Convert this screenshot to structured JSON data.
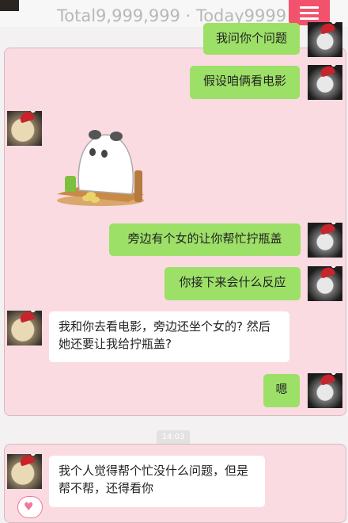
{
  "header": {
    "stats": "Total9,999,999 · Today9999"
  },
  "messages": [
    {
      "side": "right",
      "text": "我问你个问题"
    },
    {
      "side": "right",
      "text": "假设咱俩看电影"
    },
    {
      "side": "left",
      "sticker": "panda-sticker"
    },
    {
      "side": "right",
      "text": "旁边有个女的让你帮忙拧瓶盖"
    },
    {
      "side": "right",
      "text": "你接下来会什么反应"
    },
    {
      "side": "left",
      "text": "我和你去看电影，旁边还坐个女的? 然后她还要让我给拧瓶盖?"
    },
    {
      "side": "right",
      "text": "嗯"
    },
    {
      "side": "left",
      "text": "我个人觉得帮个忙没什么问题，但是帮不帮，还得看你"
    }
  ],
  "timestamp": "14:03",
  "colors": {
    "pink_panel": "#fadbe1",
    "green_bubble": "#9de068",
    "accent": "#f2526b"
  }
}
